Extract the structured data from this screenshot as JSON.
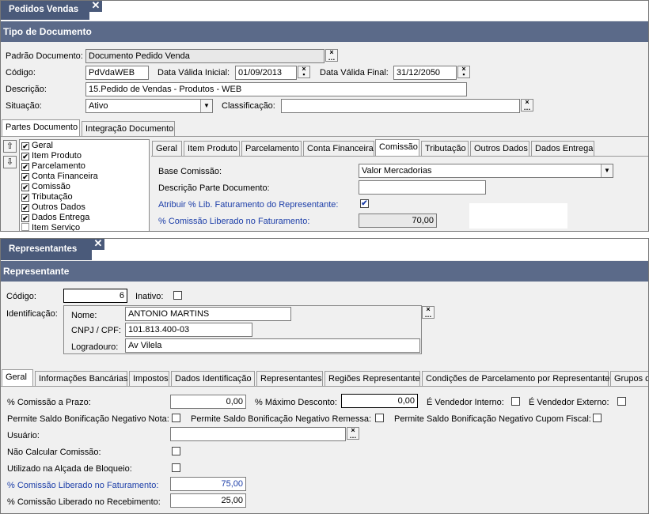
{
  "win1": {
    "tab_title": "Pedidos Vendas",
    "close_glyph": "✕",
    "header": "Tipo de Documento",
    "padrao": {
      "label": "Padrão Documento:",
      "value": "Documento Pedido Venda"
    },
    "codigo": {
      "label": "Código:",
      "value": "PdVdaWEB"
    },
    "data_inicial": {
      "label": "Data Válida Inicial:",
      "value": "01/09/2013"
    },
    "data_final": {
      "label": "Data Válida Final:",
      "value": "31/12/2050"
    },
    "descricao": {
      "label": "Descrição:",
      "value": "15.Pedido de Vendas - Produtos - WEB"
    },
    "situacao": {
      "label": "Situação:",
      "value": "Ativo"
    },
    "classificacao": {
      "label": "Classificação:",
      "value": ""
    },
    "outer_tabs": [
      "Partes Documento",
      "Integração Documento"
    ],
    "parts_list": [
      {
        "label": "Geral",
        "checked": true
      },
      {
        "label": "Item Produto",
        "checked": true
      },
      {
        "label": "Parcelamento",
        "checked": true
      },
      {
        "label": "Conta Financeira",
        "checked": true
      },
      {
        "label": "Comissão",
        "checked": true
      },
      {
        "label": "Tributação",
        "checked": true
      },
      {
        "label": "Outros Dados",
        "checked": true
      },
      {
        "label": "Dados Entrega",
        "checked": true
      },
      {
        "label": "Item Serviço",
        "checked": false
      }
    ],
    "inner_tabs": [
      "Geral",
      "Item Produto",
      "Parcelamento",
      "Conta Financeira",
      "Comissão",
      "Tributação",
      "Outros Dados",
      "Dados Entrega"
    ],
    "active_inner_tab": "Comissão",
    "base_comissao": {
      "label": "Base Comissão:",
      "value": "Valor Mercadorias"
    },
    "descricao_parte": {
      "label": "Descrição Parte Documento:",
      "value": ""
    },
    "atribuir": {
      "label": "Atribuir % Lib. Faturamento do Representante:",
      "checked": true
    },
    "comissao_fat": {
      "label": "% Comissão Liberado no Faturamento:",
      "value": "70,00"
    }
  },
  "win2": {
    "tab_title": "Representantes",
    "close_glyph": "✕",
    "header": "Representante",
    "codigo": {
      "label": "Código:",
      "value": "6"
    },
    "inativo": {
      "label": "Inativo:",
      "checked": false
    },
    "identificacao_label": "Identificação:",
    "nome": {
      "label": "Nome:",
      "value": "ANTONIO MARTINS"
    },
    "cnpj": {
      "label": "CNPJ / CPF:",
      "value": "101.813.400-03"
    },
    "logradouro": {
      "label": "Logradouro:",
      "value": "Av Vilela"
    },
    "tabs": [
      "Geral",
      "Informações Bancárias",
      "Impostos",
      "Dados Identificação",
      "Representantes",
      "Regiões Representante",
      "Condições de Parcelamento por Representante",
      "Grupos de"
    ],
    "comissao_prazo": {
      "label": "% Comissão a Prazo:",
      "value": "0,00"
    },
    "max_desconto": {
      "label": "% Máximo Desconto:",
      "value": "0,00"
    },
    "vend_interno": {
      "label": "É Vendedor Interno:",
      "checked": false
    },
    "vend_externo": {
      "label": "É Vendedor Externo:",
      "checked": false
    },
    "bonif_nota": {
      "label": "Permite Saldo Bonificação Negativo Nota:",
      "checked": false
    },
    "bonif_remessa": {
      "label": "Permite Saldo Bonificação Negativo Remessa:",
      "checked": false
    },
    "bonif_cupom": {
      "label": "Permite Saldo Bonificação Negativo Cupom Fiscal:",
      "checked": false
    },
    "usuario": {
      "label": "Usuário:",
      "value": ""
    },
    "nao_calcular": {
      "label": "Não Calcular Comissão:",
      "checked": false
    },
    "alcada": {
      "label": "Utilizado na Alçada de Bloqueio:",
      "checked": false
    },
    "comissao_fat": {
      "label": "% Comissão Liberado no Faturamento:",
      "value": "75,00"
    },
    "comissao_rec": {
      "label": "% Comissão Liberado no Recebimento:",
      "value": "25,00"
    }
  }
}
